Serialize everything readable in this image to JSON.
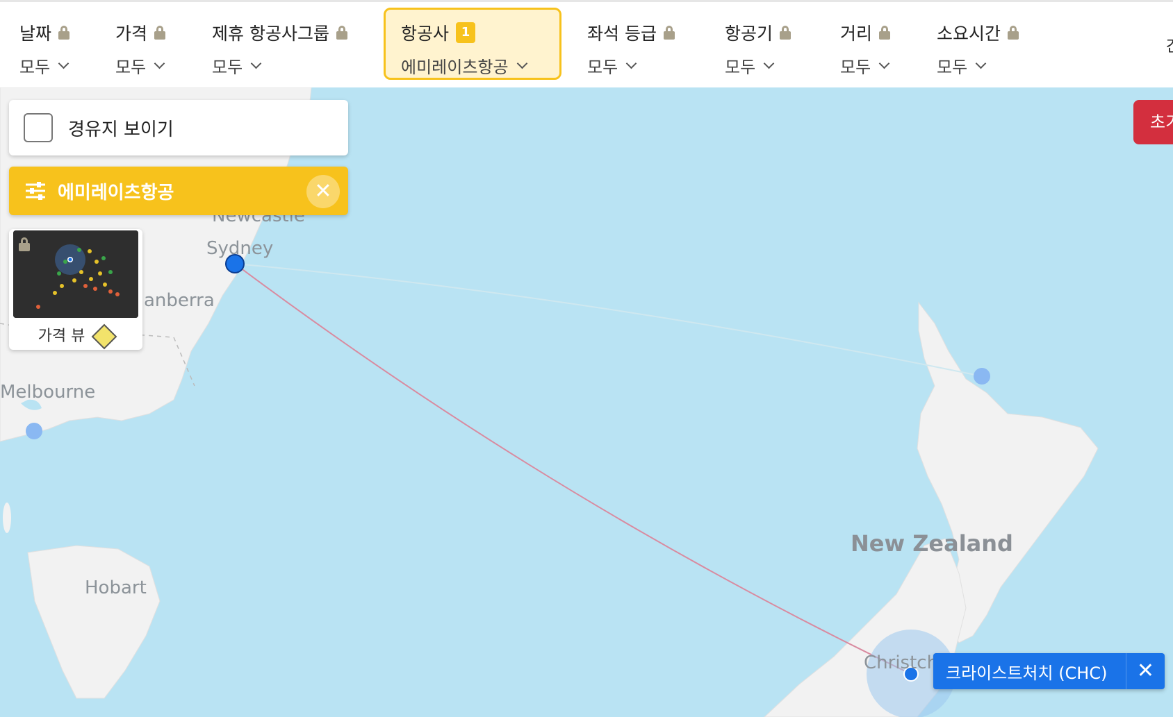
{
  "filters": [
    {
      "label": "날짜",
      "value": "모두",
      "locked": true
    },
    {
      "label": "가격",
      "value": "모두",
      "locked": true
    },
    {
      "label": "제휴 항공사그룹",
      "value": "모두",
      "locked": true
    },
    {
      "label": "항공사",
      "value": "에미레이츠항공",
      "badge": "1",
      "active": true
    },
    {
      "label": "좌석 등급",
      "value": "모두",
      "locked": true
    },
    {
      "label": "항공기",
      "value": "모두",
      "locked": true
    },
    {
      "label": "거리",
      "value": "모두",
      "locked": true
    },
    {
      "label": "소요시간",
      "value": "모두",
      "locked": true
    }
  ],
  "edge_text": "간",
  "stopover": {
    "label": "경유지 보이기",
    "checked": false
  },
  "airline_chip": {
    "label": "에미레이츠항공"
  },
  "price_view": {
    "label": "가격 뷰"
  },
  "reset_button": {
    "label": "초기"
  },
  "selected_airport": {
    "label": "크라이스트처치 (CHC)"
  },
  "map": {
    "places": [
      "Newcastle",
      "Sydney",
      "anberra",
      "Melbourne",
      "Hobart",
      "Christch"
    ],
    "country": "New Zealand"
  },
  "colors": {
    "accent": "#f7c21c",
    "route": "#d98ba0",
    "airport": "#1a73e8",
    "reset": "#d32f3e",
    "water": "#b9e3f3",
    "land": "#f2f2f2"
  }
}
